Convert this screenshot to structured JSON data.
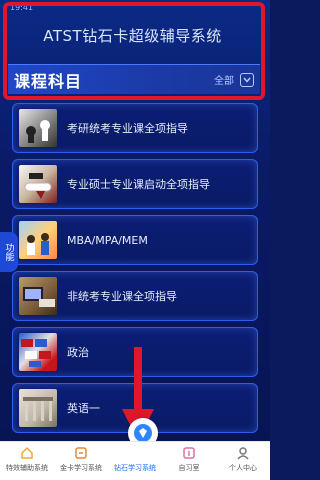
{
  "status_bar": {
    "time": "19:41"
  },
  "header": {
    "title": "ATST钻石卡超级辅导系统",
    "section_title": "课程科目",
    "all_label": "全部"
  },
  "side_tab": {
    "label": "功能"
  },
  "courses": [
    {
      "label": "考研统考专业课全项指导",
      "thumb": "thumb-chess"
    },
    {
      "label": "专业硕士专业课启动全项指导",
      "thumb": "thumb-diploma"
    },
    {
      "label": "MBA/MPA/MEM",
      "thumb": "thumb-people"
    },
    {
      "label": "非统考专业课全项指导",
      "thumb": "thumb-desk"
    },
    {
      "label": "政治",
      "thumb": "thumb-flags"
    },
    {
      "label": "英语一",
      "thumb": "thumb-building"
    }
  ],
  "bottom_nav": {
    "items": [
      {
        "label": "特效辅助系统",
        "icon": "home-icon"
      },
      {
        "label": "金卡学习系统",
        "icon": "gold-card-icon"
      },
      {
        "label": "钻石学习系统",
        "icon": "diamond-icon"
      },
      {
        "label": "自习室",
        "icon": "study-room-icon"
      },
      {
        "label": "个人中心",
        "icon": "person-icon"
      }
    ],
    "active_index": 2
  },
  "colors": {
    "accent": "#1f6cff",
    "annotation_red": "#e0162b",
    "background": "#0a1a66"
  }
}
